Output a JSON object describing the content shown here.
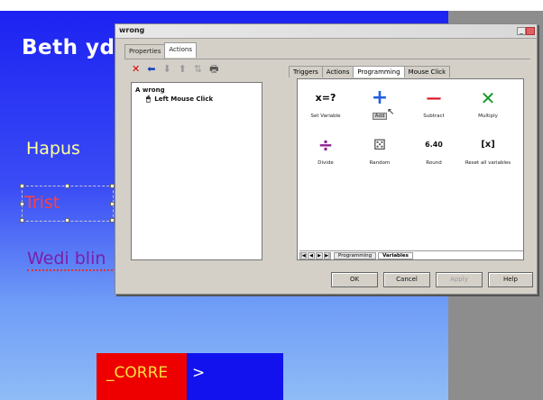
{
  "slide": {
    "title": "Beth ydy",
    "word1": "Hapus",
    "word2": "Trist",
    "word3": "Wedi blin",
    "correct_text": "_CORRE",
    "arrow": ">"
  },
  "dialog": {
    "title": "wrong",
    "tabs": [
      {
        "label": "Properties"
      },
      {
        "label": "Actions"
      }
    ],
    "toolbar": {
      "delete": "✕",
      "back": "⬅",
      "down": "⬇",
      "up": "⬆",
      "move": "⇅",
      "print": "🖶"
    },
    "tree": {
      "root": "wrong",
      "root_letter": "A",
      "child": "Left Mouse Click"
    },
    "right_tabs": [
      {
        "label": "Triggers"
      },
      {
        "label": "Actions"
      },
      {
        "label": "Programming"
      },
      {
        "label": "Mouse Click"
      }
    ],
    "items": [
      {
        "glyph": "x=?",
        "label": "Set Variable"
      },
      {
        "glyph": "+",
        "label": "Add"
      },
      {
        "glyph": "—",
        "label": "Subtract"
      },
      {
        "glyph": "✕",
        "label": "Multiply"
      },
      {
        "glyph": "÷",
        "label": "Divide"
      },
      {
        "glyph": "⚄",
        "label": "Random"
      },
      {
        "glyph": "6.40",
        "label": "Round"
      },
      {
        "glyph": "[x]",
        "label": "Reset all variables"
      }
    ],
    "bottom_tabs": [
      {
        "label": "Programming"
      },
      {
        "label": "Variables"
      }
    ],
    "buttons": {
      "ok": "OK",
      "cancel": "Cancel",
      "apply": "Apply",
      "help": "Help"
    }
  },
  "colors": {
    "slide_top": "#1c22f2",
    "slide_bottom": "#8fbcf6",
    "accent_red": "#ee0000",
    "accent_blue": "#1212ee"
  }
}
